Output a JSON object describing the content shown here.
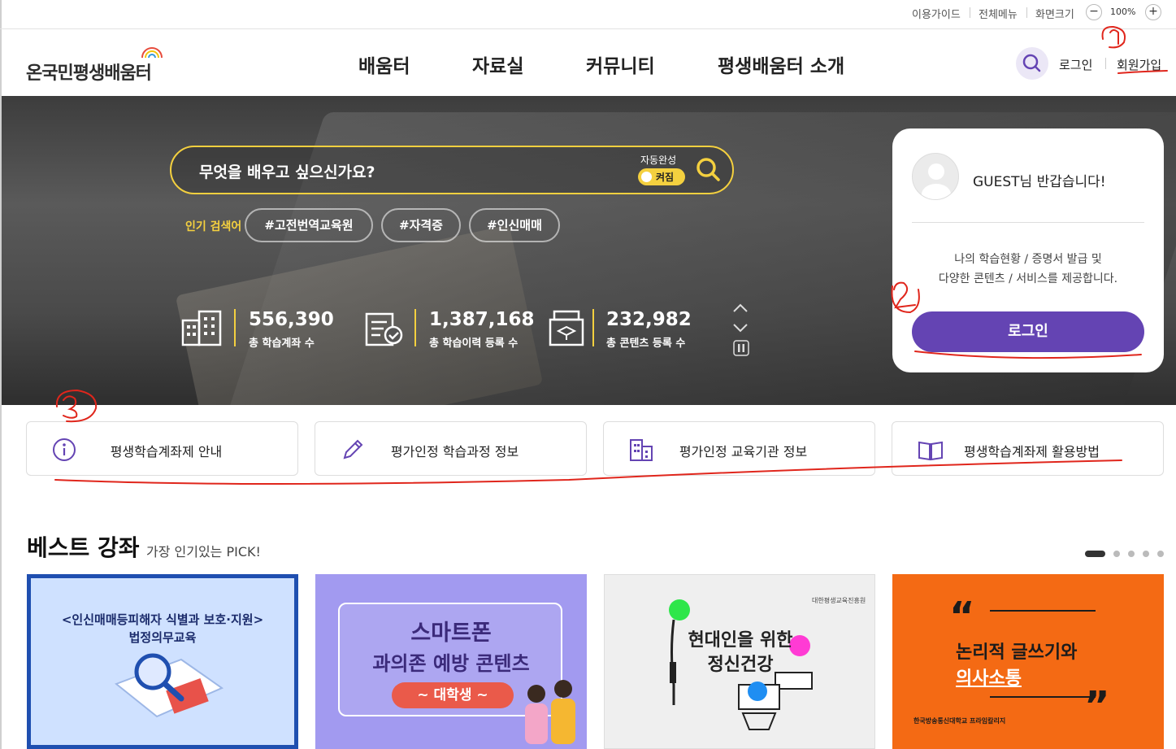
{
  "util": {
    "guide": "이용가이드",
    "allmenu": "전체메뉴",
    "screensize": "화면크기",
    "zoom_minus": "−",
    "zoom": "100%",
    "zoom_plus": "+"
  },
  "header": {
    "logo": "온국민평생배움터",
    "nav": [
      "배움터",
      "자료실",
      "커뮤니티",
      "평생배움터 소개"
    ],
    "login": "로그인",
    "signup": "회원가입"
  },
  "hero": {
    "search_placeholder": "무엇을 배우고 싶으신가요?",
    "autocomplete_label": "자동완성",
    "autocomplete_state": "켜짐",
    "keywords_label": "인기 검색어",
    "keywords": [
      "#고전번역교육원",
      "#자격증",
      "#인신매매"
    ],
    "stats": [
      {
        "value": "556,390",
        "label": "총 학습계좌 수"
      },
      {
        "value": "1,387,168",
        "label": "총 학습이력 등록 수"
      },
      {
        "value": "232,982",
        "label": "총 콘텐츠 등록 수"
      }
    ]
  },
  "login_card": {
    "greeting": "GUEST님 반갑습니다!",
    "desc1": "나의 학습현황 / 증명서 발급 및",
    "desc2": "다양한 콘텐츠 / 서비스를 제공합니다.",
    "button": "로그인"
  },
  "quick_menu": [
    "평생학습계좌제 안내",
    "평가인정 학습과정 정보",
    "평가인정 교육기관 정보",
    "평생학습계좌제 활용방법"
  ],
  "best": {
    "title": "베스트 강좌",
    "subtitle": "가장 인기있는 PICK!",
    "cards": [
      {
        "line1": "<인신매매등피해자 식별과 보호·지원>",
        "line2": "법정의무교육"
      },
      {
        "line1": "스마트폰",
        "line2": "과의존 예방 콘텐츠",
        "line3": "~ 대학생 ~"
      },
      {
        "line1": "현대인을 위한",
        "line2": "정신건강",
        "org": "대한평생교육진흥원"
      },
      {
        "line1": "논리적 글쓰기와",
        "line2": "의사소통",
        "org": "한국방송통신대학교 프라임칼리지"
      }
    ]
  },
  "annotations": [
    "1",
    "2",
    "3"
  ],
  "colors": {
    "accent": "#6444b3",
    "yellow": "#f4d03f",
    "annotation": "#e0261c"
  }
}
